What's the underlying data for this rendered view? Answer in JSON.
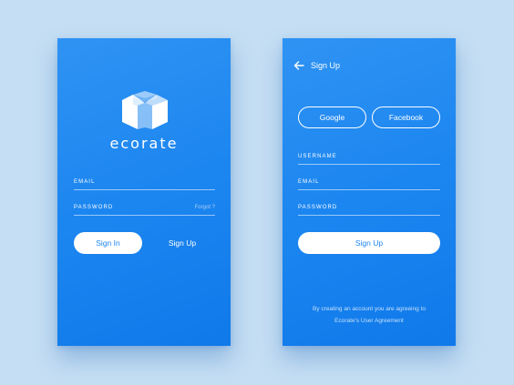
{
  "sign_in_screen": {
    "logo_icon": "cube-logo-icon",
    "brand_name": "ecorate",
    "email_label": "EMAIL",
    "password_label": "PASSWORD",
    "forgot_label": "Forgot ?",
    "sign_in_button": "Sign In",
    "sign_up_link": "Sign Up"
  },
  "sign_up_screen": {
    "back_icon": "arrow-left-icon",
    "title": "Sign Up",
    "google_button": "Google",
    "facebook_button": "Facebook",
    "username_label": "USERNAME",
    "email_label": "EMAIL",
    "password_label": "PASSWORD",
    "sign_up_button": "Sign Up",
    "legal_line1": "By creating an account you are agreeing to",
    "legal_line2": "Ecorate's User Agreement"
  },
  "colors": {
    "background": "#c5def3",
    "primary_blue": "#1c86f0",
    "white": "#ffffff"
  }
}
